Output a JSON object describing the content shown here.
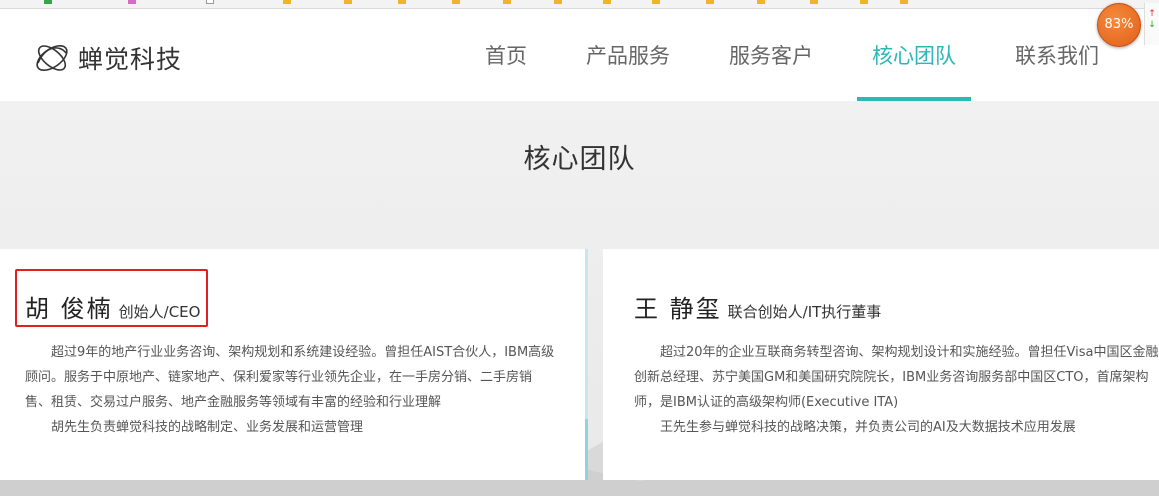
{
  "header": {
    "logo_text": "蝉觉科技",
    "nav": [
      {
        "label": "首页",
        "active": false
      },
      {
        "label": "产品服务",
        "active": false
      },
      {
        "label": "服务客户",
        "active": false
      },
      {
        "label": "核心团队",
        "active": true
      },
      {
        "label": "联系我们",
        "active": false
      }
    ]
  },
  "extension_badge": {
    "value": "83%",
    "up_arrow": "↑",
    "down_arrow": "↓"
  },
  "section": {
    "title": "核心团队"
  },
  "team": [
    {
      "name": "胡 俊楠",
      "role": "创始人/CEO",
      "bio": [
        "超过9年的地产行业业务咨询、架构规划和系统建设经验。曾担任AIST合伙人，IBM高级顾问。服务于中原地产、链家地产、保利爱家等行业领先企业，在一手房分销、二手房销售、租赁、交易过户服务、地产金融服务等领域有丰富的经验和行业理解",
        "胡先生负责蝉觉科技的战略制定、业务发展和运营管理"
      ]
    },
    {
      "name": "王 静玺",
      "role": "联合创始人/IT执行董事",
      "bio": [
        "超过20年的企业互联商务转型咨询、架构规划设计和实施经验。曾担任Visa中国区金融创新总经理、苏宁美国GM和美国研究院院长，IBM业务咨询服务部中国区CTO，首席架构师，是IBM认证的高级架构师(Executive ITA)",
        "王先生参与蝉觉科技的战略决策，并负责公司的AI及大数据技术应用发展"
      ]
    }
  ],
  "colors": {
    "accent": "#2bb8b8",
    "highlight_border": "#e02020",
    "badge": "#e8712a"
  }
}
